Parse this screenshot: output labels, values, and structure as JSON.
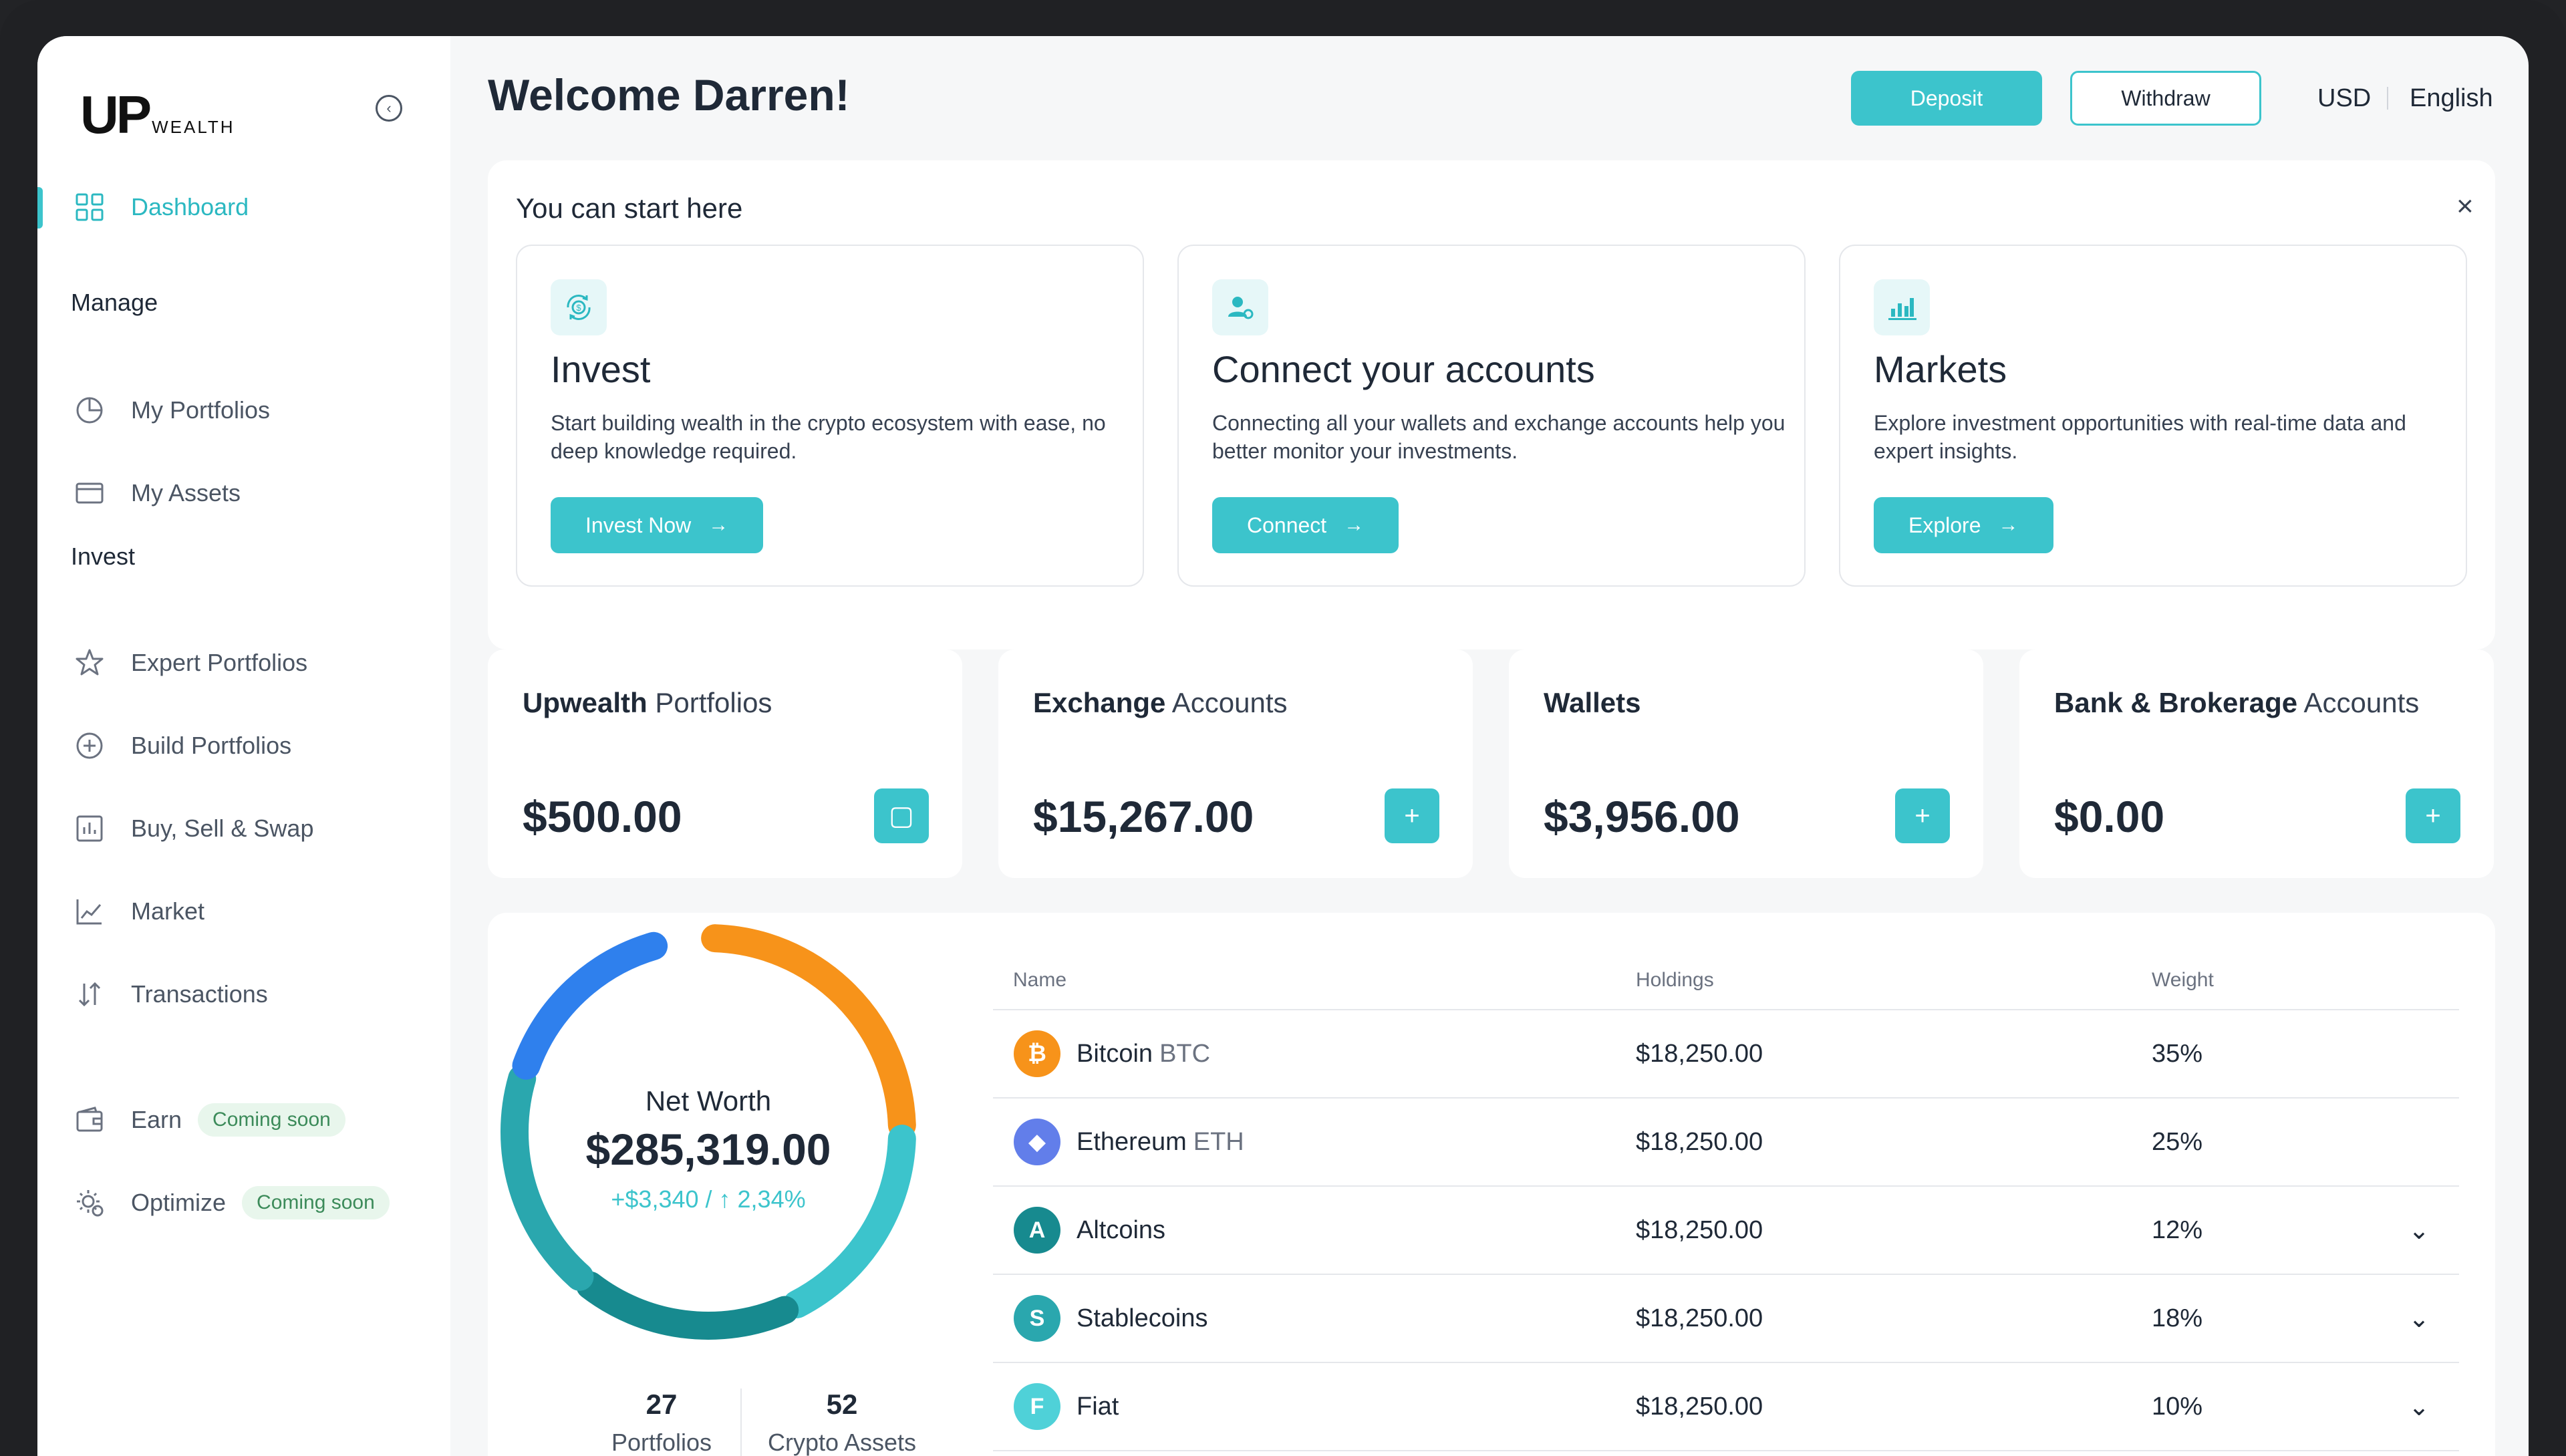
{
  "brand": {
    "logo_main": "UP",
    "logo_sub": "WEALTH",
    "accent": "#3cc4cc"
  },
  "sidebar": {
    "dashboard": "Dashboard",
    "manage_heading": "Manage",
    "manage_items": [
      "My Portfolios",
      "My Assets"
    ],
    "invest_heading": "Invest",
    "invest_items": [
      "Expert Portfolios",
      "Build Portfolios",
      "Buy, Sell & Swap",
      "Market",
      "Transactions"
    ],
    "earn": {
      "label": "Earn",
      "badge": "Coming soon"
    },
    "optimize": {
      "label": "Optimize",
      "badge": "Coming soon"
    }
  },
  "header": {
    "welcome": "Welcome Darren!",
    "deposit": "Deposit",
    "withdraw": "Withdraw",
    "currency": "USD",
    "language": "English"
  },
  "start": {
    "title": "You can start here",
    "close": "×",
    "cards": [
      {
        "icon": "invest-icon",
        "title": "Invest",
        "desc": "Start building wealth in the crypto ecosystem with ease, no deep knowledge required.",
        "button": "Invest Now"
      },
      {
        "icon": "connect-accounts-icon",
        "title": "Connect your accounts",
        "desc": "Connecting all your wallets and exchange accounts help you better monitor your investments.",
        "button": "Connect"
      },
      {
        "icon": "markets-chart-icon",
        "title": "Markets",
        "desc": "Explore investment opportunities with real-time data and expert insights.",
        "button": "Explore"
      }
    ]
  },
  "summary": [
    {
      "title_bold": "Upwealth",
      "title_rest": " Portfolios",
      "value": "$500.00",
      "button": "▢"
    },
    {
      "title_bold": "Exchange",
      "title_rest": " Accounts",
      "value": "$15,267.00",
      "button": "+"
    },
    {
      "title_bold": "Wallets",
      "title_rest": "",
      "value": "$3,956.00",
      "button": "+"
    },
    {
      "title_bold": "Bank & Brokerage",
      "title_rest": " Accounts",
      "value": "$0.00",
      "button": "+"
    }
  ],
  "networth": {
    "label": "Net Worth",
    "value": "$285,319.00",
    "change": "+$3,340 / ↑ 2,34%",
    "portfolios_count": "27",
    "portfolios_label": "Portfolios",
    "crypto_count": "52",
    "crypto_label": "Crypto Assets",
    "donut_segments": [
      {
        "color": "#f7931a",
        "share": 0.25
      },
      {
        "color": "#3cc4cc",
        "share": 0.18
      },
      {
        "color": "#178a8f",
        "share": 0.18
      },
      {
        "color": "#2aa7ae",
        "share": 0.19
      },
      {
        "color": "#2f80ed",
        "share": 0.16
      }
    ]
  },
  "assets_table": {
    "columns": [
      "Name",
      "Holdings",
      "Weight"
    ],
    "rows": [
      {
        "name": "Bitcoin",
        "ticker": "BTC",
        "holdings": "$18,250.00",
        "weight": "35%",
        "coin": "₿",
        "color": "#f7931a",
        "expand": ""
      },
      {
        "name": "Ethereum",
        "ticker": "ETH",
        "holdings": "$18,250.00",
        "weight": "25%",
        "coin": "◆",
        "color": "#627eea",
        "expand": ""
      },
      {
        "name": "Altcoins",
        "ticker": "",
        "holdings": "$18,250.00",
        "weight": "12%",
        "coin": "A",
        "color": "#178a8f",
        "expand": "⌄"
      },
      {
        "name": "Stablecoins",
        "ticker": "",
        "holdings": "$18,250.00",
        "weight": "18%",
        "coin": "S",
        "color": "#2aa7ae",
        "expand": "⌄"
      },
      {
        "name": "Fiat",
        "ticker": "",
        "holdings": "$18,250.00",
        "weight": "10%",
        "coin": "F",
        "color": "#4fd1d8",
        "expand": "⌄"
      }
    ]
  }
}
